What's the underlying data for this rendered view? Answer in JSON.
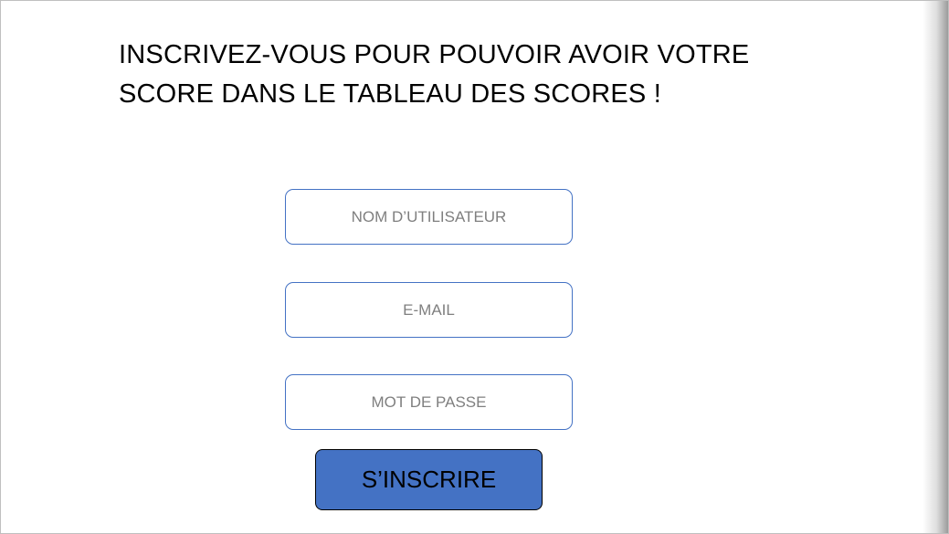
{
  "heading": {
    "line1": "INSCRIVEZ-VOUS POUR POUVOIR AVOIR VOTRE",
    "line2": "SCORE DANS LE TABLEAU DES SCORES !"
  },
  "form": {
    "username_placeholder": "NOM D’UTILISATEUR",
    "email_placeholder": "E-MAIL",
    "password_placeholder": "MOT DE PASSE",
    "submit_label": "S’INSCRIRE"
  },
  "colors": {
    "accent": "#4472c4",
    "placeholder_text": "#7f7f7f"
  }
}
